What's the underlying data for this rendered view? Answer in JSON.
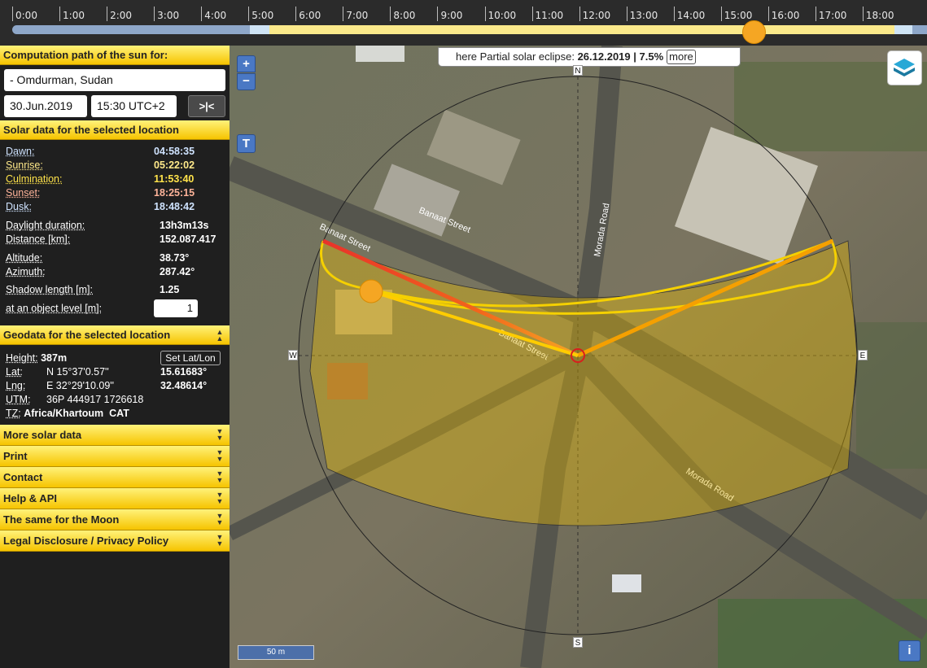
{
  "timeline": {
    "hours": [
      "0:00",
      "1:00",
      "2:00",
      "3:00",
      "4:00",
      "5:00",
      "6:00",
      "7:00",
      "8:00",
      "9:00",
      "10:00",
      "11:00",
      "12:00",
      "13:00",
      "14:00",
      "15:00",
      "16:00",
      "17:00",
      "18:00"
    ],
    "current_fraction": 0.646
  },
  "location_panel": {
    "title": "Computation path of the sun for:",
    "location": "- Omdurman, Sudan",
    "date": "30.Jun.2019",
    "time": "15:30 UTC+2",
    "now_button": ">|<"
  },
  "solar_panel": {
    "title": "Solar data for the selected location",
    "dawn_label": "Dawn:",
    "dawn": "04:58:35",
    "sunrise_label": "Sunrise:",
    "sunrise": "05:22:02",
    "culmination_label": "Culmination:",
    "culmination": "11:53:40",
    "sunset_label": "Sunset:",
    "sunset": "18:25:15",
    "dusk_label": "Dusk:",
    "dusk": "18:48:42",
    "daylight_label": "Daylight duration:",
    "daylight": "13h3m13s",
    "distance_label": "Distance [km]:",
    "distance": "152.087.417",
    "altitude_label": "Altitude:",
    "altitude": "38.73°",
    "azimuth_label": "Azimuth:",
    "azimuth": "287.42°",
    "shadow_label": "Shadow length [m]:",
    "shadow": "1.25",
    "object_level_label": "at an object level [m]:",
    "object_level": "1"
  },
  "geo_panel": {
    "title": "Geodata for the selected location",
    "height_label": "Height:",
    "height": "387m",
    "set_button": "Set Lat/Lon",
    "lat_label": "Lat:",
    "lat_dms": "N 15°37'0.57''",
    "lat_dec": "15.61683°",
    "lng_label": "Lng:",
    "lng_dms": "E 32°29'10.09''",
    "lng_dec": "32.48614°",
    "utm_label": "UTM:",
    "utm": "36P 444917 1726618",
    "tz_label": "TZ:",
    "tz": "Africa/Khartoum  CAT"
  },
  "collapsed_panels": [
    "More solar data",
    "Print",
    "Contact",
    "Help & API",
    "The same for the Moon",
    "Legal Disclosure / Privacy Policy"
  ],
  "map": {
    "zoom_in": "+",
    "zoom_out": "−",
    "terrain_button": "T",
    "eclipse_prefix": "here Partial solar eclipse: ",
    "eclipse_date_pct": "26.12.2019 | 7.5%",
    "more": "more",
    "compass": {
      "n": "N",
      "s": "S",
      "e": "E",
      "w": "W"
    },
    "street_labels": [
      "Banaat Street",
      "Banaat Street",
      "Banaat Street",
      "Morada Road",
      "Morada Road"
    ],
    "scale": "50 m",
    "info": "i",
    "icons": {
      "layers": "layers-icon",
      "info": "info-icon"
    }
  },
  "colors": {
    "accent_yellow": "#f6c400",
    "sun_orange": "#f5a623",
    "sunrise_line": "#f5d000",
    "sunset_line": "#e8322a",
    "current_line": "#ff9a1a",
    "dawn_text": "#cfe3ff",
    "sunrise_text": "#ffe98a",
    "culm_text": "#ffe34a",
    "sunset_text": "#ffb49a"
  }
}
